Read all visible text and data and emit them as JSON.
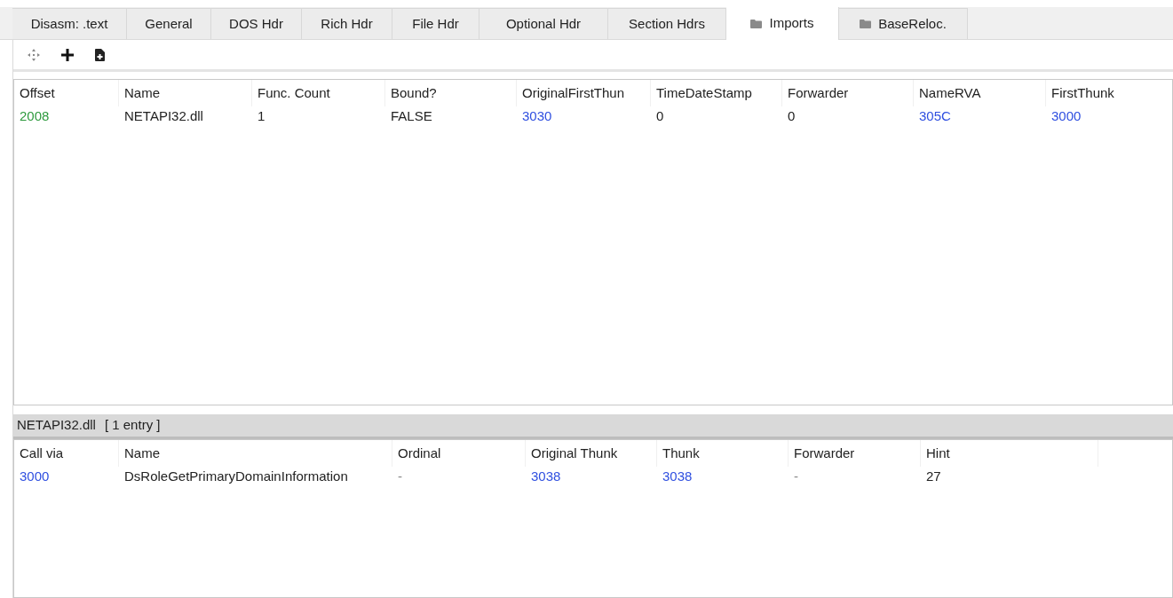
{
  "tabs": [
    {
      "label": "Disasm: .text",
      "selected": false,
      "kind": "plain"
    },
    {
      "label": "General",
      "selected": false,
      "kind": "plain"
    },
    {
      "label": "DOS Hdr",
      "selected": false,
      "kind": "plain"
    },
    {
      "label": "Rich Hdr",
      "selected": false,
      "kind": "plain"
    },
    {
      "label": "File Hdr",
      "selected": false,
      "kind": "plain"
    },
    {
      "label": "Optional Hdr",
      "selected": false,
      "kind": "plain"
    },
    {
      "label": "Section Hdrs",
      "selected": false,
      "kind": "plain"
    },
    {
      "label": "Imports",
      "selected": true,
      "kind": "folder"
    },
    {
      "label": "BaseReloc.",
      "selected": false,
      "kind": "folder"
    }
  ],
  "toolbar": [
    {
      "kind": "move"
    },
    {
      "kind": "add"
    },
    {
      "kind": "add-file"
    }
  ],
  "imports_table": {
    "columns": [
      "Offset",
      "Name",
      "Func. Count",
      "Bound?",
      "OriginalFirstThun",
      "TimeDateStamp",
      "Forwarder",
      "NameRVA",
      "FirstThunk"
    ],
    "rows": [
      [
        {
          "text": "2008",
          "kind": "offset"
        },
        {
          "text": "NETAPI32.dll",
          "kind": "plain"
        },
        {
          "text": "1",
          "kind": "plain"
        },
        {
          "text": "FALSE",
          "kind": "plain"
        },
        {
          "text": "3030",
          "kind": "address"
        },
        {
          "text": "0",
          "kind": "plain"
        },
        {
          "text": "0",
          "kind": "plain"
        },
        {
          "text": "305C",
          "kind": "address"
        },
        {
          "text": "3000",
          "kind": "address"
        }
      ]
    ]
  },
  "functions_header": {
    "dll": "NETAPI32.dll",
    "count": "[ 1 entry ]"
  },
  "functions_table": {
    "columns": [
      "Call via",
      "Name",
      "Ordinal",
      "Original Thunk",
      "Thunk",
      "Forwarder",
      "Hint"
    ],
    "rows": [
      [
        {
          "text": "3000",
          "kind": "address"
        },
        {
          "text": "DsRoleGetPrimaryDomainInformation",
          "kind": "plain"
        },
        {
          "text": "-",
          "kind": "dim"
        },
        {
          "text": "3038",
          "kind": "address"
        },
        {
          "text": "3038",
          "kind": "address"
        },
        {
          "text": "-",
          "kind": "dim"
        },
        {
          "text": "27",
          "kind": "plain"
        }
      ]
    ]
  }
}
